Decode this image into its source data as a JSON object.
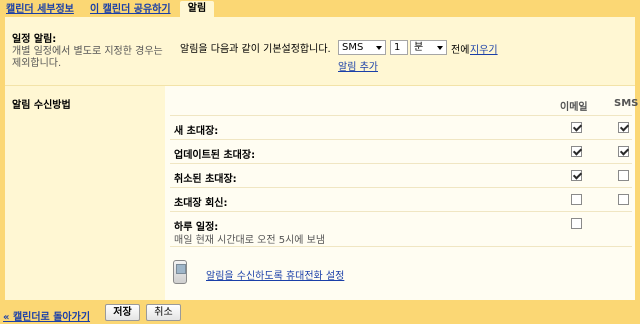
{
  "tabs": [
    {
      "label": "캘린더 세부정보",
      "active": false
    },
    {
      "label": "이 캘린더 공유하기",
      "active": false
    },
    {
      "label": "알림",
      "active": true
    }
  ],
  "event_reminders": {
    "title": "일정 알림:",
    "description_line1": "개별 일정에서 별도로 지정한 경우는",
    "description_line2": "제외합니다.",
    "default_text": "알림을 다음과 같이 기본설정합니다.",
    "method_value": "SMS",
    "amount_value": "1",
    "unit_value": "분",
    "before_text": "전에",
    "remove_link": "지우기",
    "add_link": "알림 추가"
  },
  "delivery": {
    "title": "알림 수신방법",
    "col_email": "이메일",
    "col_sms": "SMS",
    "rows": [
      {
        "label": "새 초대장:",
        "sub": "",
        "email": true,
        "sms": true
      },
      {
        "label": "업데이트된 초대장:",
        "sub": "",
        "email": true,
        "sms": true
      },
      {
        "label": "취소된 초대장:",
        "sub": "",
        "email": true,
        "sms": false
      },
      {
        "label": "초대장 회신:",
        "sub": "",
        "email": false,
        "sms": false
      },
      {
        "label": "하루 일정:",
        "sub": "매일 현재 시간대로 오전 5시에 보냄",
        "email": false,
        "sms": null
      }
    ],
    "phone_setup_link": "알림을 수신하도록 휴대전화 설정"
  },
  "footer": {
    "back_link": "« 캘린더로 돌아가기",
    "save_label": "저장",
    "cancel_label": "취소"
  },
  "colors": {
    "tabbar": "#fbd774",
    "panel": "#fff7d3",
    "link": "#1a3fa8"
  }
}
